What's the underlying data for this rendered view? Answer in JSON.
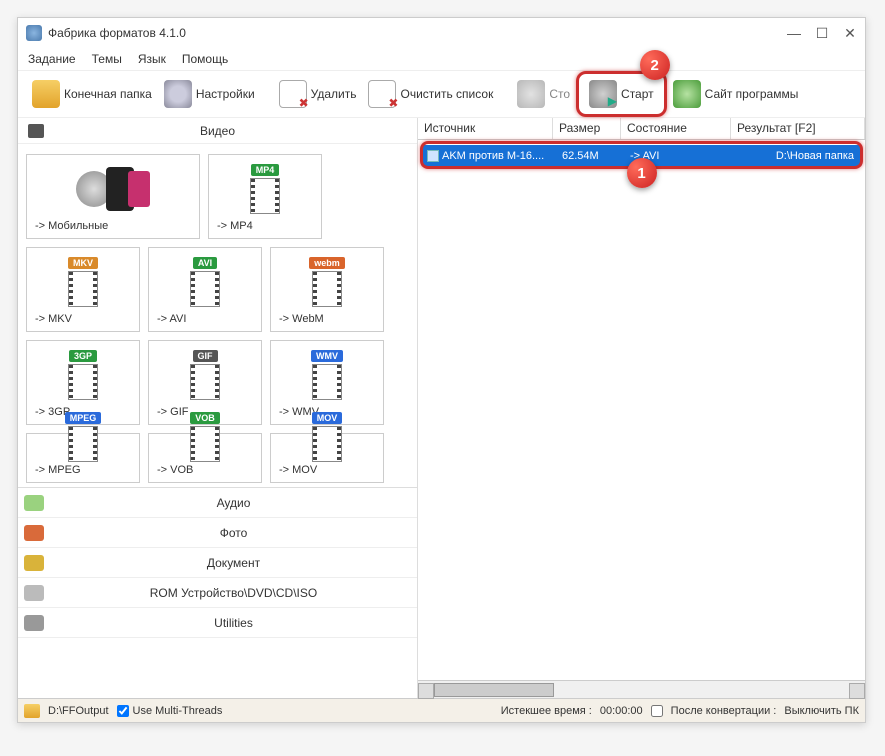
{
  "title": "Фабрика форматов 4.1.0",
  "menu": [
    "Задание",
    "Темы",
    "Язык",
    "Помощь"
  ],
  "toolbar": {
    "output_folder": "Конечная папка",
    "settings": "Настройки",
    "delete": "Удалить",
    "clear_list": "Очистить список",
    "stop": "Сто",
    "start": "Старт",
    "site": "Сайт программы"
  },
  "left": {
    "active_category": "Видео",
    "tiles": [
      {
        "label": "-> Мобильные",
        "big": true
      },
      {
        "label": "-> MP4",
        "tag": "MP4",
        "tag_color": "#2a9a3f"
      },
      {
        "label": "-> MKV",
        "tag": "MKV",
        "tag_color": "#d98a2b"
      },
      {
        "label": "-> AVI",
        "tag": "AVI",
        "tag_color": "#2a9a3f"
      },
      {
        "label": "-> WebM",
        "tag": "webm",
        "tag_color": "#d9642b"
      },
      {
        "label": "-> 3GP",
        "tag": "3GP",
        "tag_color": "#2a9a3f"
      },
      {
        "label": "-> GIF",
        "tag": "GIF",
        "tag_color": "#555"
      },
      {
        "label": "-> WMV",
        "tag": "WMV",
        "tag_color": "#2a6adb"
      },
      {
        "label": "-> MPEG",
        "tag": "MPEG",
        "tag_color": "#2a6adb",
        "cut": true
      },
      {
        "label": "-> VOB",
        "tag": "VOB",
        "tag_color": "#2a9a3f",
        "cut": true
      },
      {
        "label": "-> MOV",
        "tag": "MOV",
        "tag_color": "#2a6adb",
        "cut": true
      }
    ],
    "categories": [
      {
        "label": "Аудио",
        "color": "#9ad27f"
      },
      {
        "label": "Фото",
        "color": "#d96a3a"
      },
      {
        "label": "Документ",
        "color": "#d9b33a"
      },
      {
        "label": "ROM Устройство\\DVD\\CD\\ISO",
        "color": "#bbb"
      },
      {
        "label": "Utilities",
        "color": "#999"
      }
    ]
  },
  "right": {
    "columns": {
      "source": "Источник",
      "size": "Размер",
      "state": "Состояние",
      "result": "Результат [F2]"
    },
    "row": {
      "source": "AKM против М-16....",
      "size": "62.54M",
      "state": "-> AVI",
      "result": "D:\\Новая папка"
    }
  },
  "badges": {
    "row": "1",
    "start": "2"
  },
  "status": {
    "path": "D:\\FFOutput",
    "multithreads": "Use Multi-Threads",
    "elapsed_label": "Истекшее время :",
    "elapsed_value": "00:00:00",
    "after_label": "После конвертации :",
    "after_value": "Выключить ПК"
  }
}
